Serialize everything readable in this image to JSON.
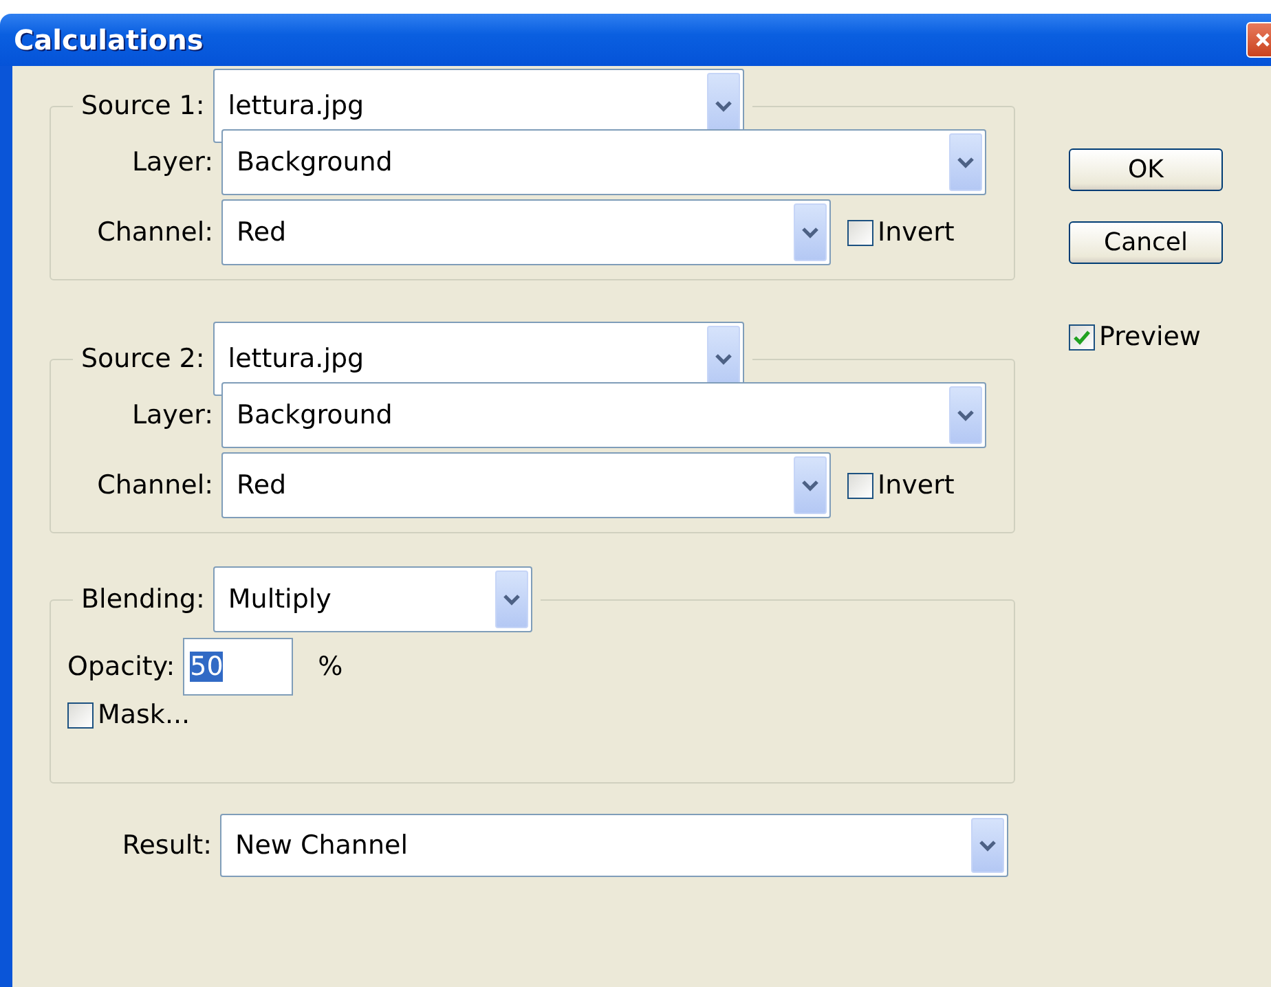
{
  "window": {
    "title": "Calculations"
  },
  "sources": [
    {
      "label": "Source 1:",
      "file": "lettura.jpg",
      "layer_label": "Layer:",
      "layer": "Background",
      "channel_label": "Channel:",
      "channel": "Red",
      "invert": {
        "label": "Invert",
        "checked": false
      }
    },
    {
      "label": "Source 2:",
      "file": "lettura.jpg",
      "layer_label": "Layer:",
      "layer": "Background",
      "channel_label": "Channel:",
      "channel": "Red",
      "invert": {
        "label": "Invert",
        "checked": false
      }
    }
  ],
  "blending": {
    "label": "Blending:",
    "value": "Multiply",
    "opacity_label": "Opacity:",
    "opacity": "50",
    "opacity_selected": true,
    "unit": "%",
    "mask": {
      "label": "Mask...",
      "checked": false
    }
  },
  "result": {
    "label": "Result:",
    "value": "New Channel"
  },
  "buttons": [
    "OK",
    "Cancel"
  ],
  "preview": {
    "label": "Preview",
    "checked": true
  }
}
